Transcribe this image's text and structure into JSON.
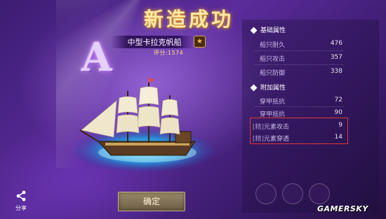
{
  "header": {
    "title": "新造成功"
  },
  "ship": {
    "grade": "A",
    "name": "中型卡拉克帆船",
    "score": "评分:1574",
    "badge_icon": "star-badge-icon"
  },
  "stats": {
    "basic_section": "基础属性",
    "basic": [
      {
        "label": "船只耐久",
        "value": "476"
      },
      {
        "label": "船只攻击",
        "value": "357"
      },
      {
        "label": "船只防御",
        "value": "338"
      }
    ],
    "extra_section": "附加属性",
    "extra": [
      {
        "label": "穿甲抵抗",
        "value": "72"
      },
      {
        "label": "穿甲抵抗",
        "value": "90"
      }
    ],
    "highlighted": [
      {
        "tag": "[精]",
        "label": "元素攻击",
        "value": "9"
      },
      {
        "tag": "[精]",
        "label": "元素穿透",
        "value": "14"
      }
    ],
    "highlight_color": "#e03a3a"
  },
  "actions": {
    "confirm_label": "确定",
    "share_label": "分享"
  },
  "watermark": "GAMERSKY",
  "colors": {
    "title": "#ffe9a6",
    "background": "#3d1d73",
    "button": "#8a7a5a"
  }
}
